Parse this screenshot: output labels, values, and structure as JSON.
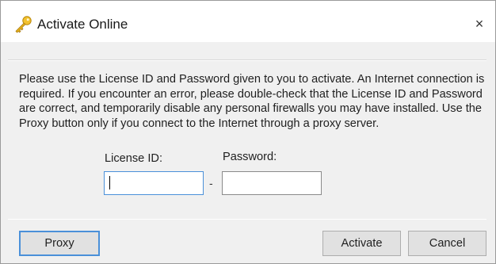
{
  "window": {
    "title": "Activate Online",
    "close_glyph": "×",
    "icon": "key-icon"
  },
  "body": {
    "message": "Please use the License ID and Password given to you to activate.  An Internet connection is required.  If you encounter an error, please double-check that the License ID and Password are correct, and temporarily disable any personal firewalls you may have installed. Use the Proxy button only if you connect to the Internet through a proxy server."
  },
  "form": {
    "license_label": "License ID:",
    "license_value": "",
    "separator": "-",
    "password_label": "Password:",
    "password_value": ""
  },
  "buttons": {
    "proxy": "Proxy",
    "activate": "Activate",
    "cancel": "Cancel"
  },
  "colors": {
    "focus_accent": "#4a90d9",
    "key_gold": "#e8b41c"
  }
}
